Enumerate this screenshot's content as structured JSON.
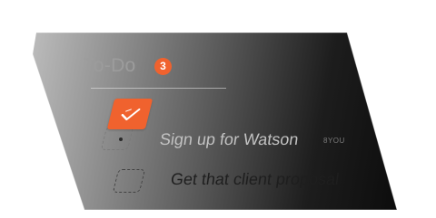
{
  "todo": {
    "title": "To-Do",
    "count": "3",
    "tasks": [
      {
        "label": "Sign up for Watson",
        "tag": "8YOU",
        "completed": false
      },
      {
        "label": "Get that client proposal",
        "completed": false
      }
    ]
  },
  "colors": {
    "accent": "#f0622e",
    "card_light": "#cfcfcf",
    "card_dark": "#050505"
  },
  "icons": {
    "check": "check-icon"
  }
}
